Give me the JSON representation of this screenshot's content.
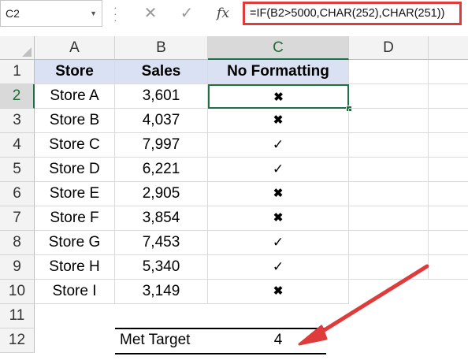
{
  "formula_bar": {
    "name_box": "C2",
    "cancel_icon": "close-icon",
    "enter_icon": "check-icon",
    "fx_label": "fx",
    "formula": "=IF(B2>5000,CHAR(252),CHAR(251))"
  },
  "columns": [
    "A",
    "B",
    "C",
    "D"
  ],
  "rows": [
    "1",
    "2",
    "3",
    "4",
    "5",
    "6",
    "7",
    "8",
    "9",
    "10",
    "11",
    "12"
  ],
  "table": {
    "headers": [
      "Store",
      "Sales",
      "No Formatting"
    ],
    "rows": [
      {
        "store": "Store A",
        "sales": "3,601",
        "mark": "✖"
      },
      {
        "store": "Store B",
        "sales": "4,037",
        "mark": "✖"
      },
      {
        "store": "Store C",
        "sales": "7,997",
        "mark": "✓"
      },
      {
        "store": "Store D",
        "sales": "6,221",
        "mark": "✓"
      },
      {
        "store": "Store E",
        "sales": "2,905",
        "mark": "✖"
      },
      {
        "store": "Store F",
        "sales": "3,854",
        "mark": "✖"
      },
      {
        "store": "Store G",
        "sales": "7,453",
        "mark": "✓"
      },
      {
        "store": "Store H",
        "sales": "5,340",
        "mark": "✓"
      },
      {
        "store": "Store I",
        "sales": "3,149",
        "mark": "✖"
      }
    ]
  },
  "summary": {
    "label": "Met Target",
    "value": "4"
  },
  "colors": {
    "header_fill": "#d9e1f2",
    "selection": "#1e7145",
    "highlight": "#e03b3b"
  }
}
